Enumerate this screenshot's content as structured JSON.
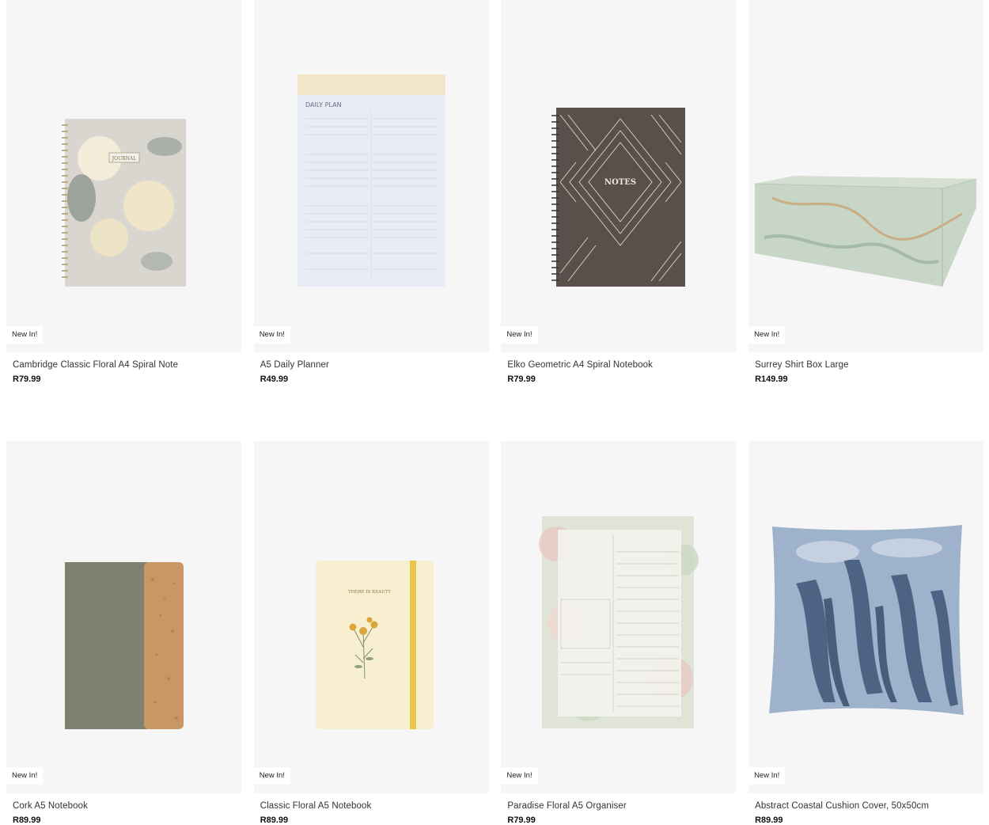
{
  "products": [
    {
      "name": "Cambridge Classic Floral A4 Spiral Note",
      "price": "R79.99",
      "badge": "New In!",
      "image_text": "JOURNAL"
    },
    {
      "name": "A5 Daily Planner",
      "price": "R49.99",
      "badge": "New In!",
      "image_text": "DAILY PLAN"
    },
    {
      "name": "Elko Geometric A4 Spiral Notebook",
      "price": "R79.99",
      "badge": "New In!",
      "image_text": "NOTES"
    },
    {
      "name": "Surrey Shirt Box Large",
      "price": "R149.99",
      "badge": "New In!",
      "image_text": ""
    },
    {
      "name": "Cork A5 Notebook",
      "price": "R89.99",
      "badge": "New In!",
      "image_text": ""
    },
    {
      "name": "Classic Floral A5 Notebook",
      "price": "R89.99",
      "badge": "New In!",
      "image_text": "THERE IS BEAUTY"
    },
    {
      "name": "Paradise Floral A5 Organiser",
      "price": "R79.99",
      "badge": "New In!",
      "image_text": ""
    },
    {
      "name": "Abstract Coastal Cushion Cover, 50x50cm",
      "price": "R89.99",
      "badge": "New In!",
      "image_text": ""
    }
  ]
}
